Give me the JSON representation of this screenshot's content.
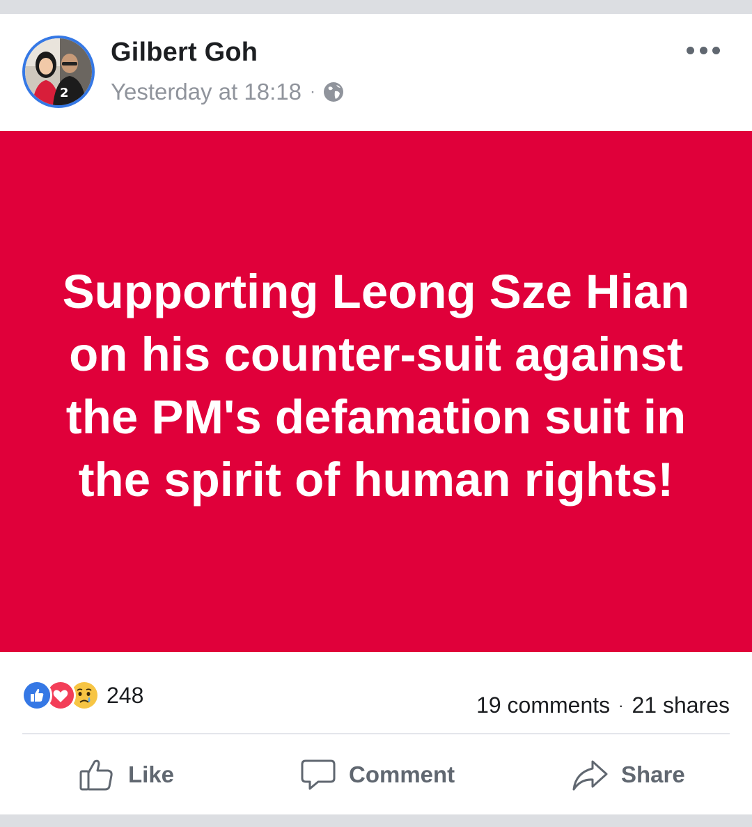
{
  "post": {
    "author": "Gilbert Goh",
    "timestamp": "Yesterday at 18:18",
    "meta_separator": "·",
    "privacy_icon": "globe-icon",
    "image_text": "Supporting Leong Sze Hian on his counter-suit against the PM's defamation suit in the spirit of human rights!",
    "image_background": "#e0003a"
  },
  "stats": {
    "reactions": [
      "like-reaction-icon",
      "love-reaction-icon",
      "sad-reaction-icon"
    ],
    "reaction_count": "248",
    "comments": "19 comments",
    "separator": "·",
    "shares": "21 shares"
  },
  "actions": {
    "like": "Like",
    "comment": "Comment",
    "share": "Share"
  },
  "colors": {
    "accent": "#3578e5",
    "muted_text": "#90949c",
    "action_text": "#606770"
  }
}
